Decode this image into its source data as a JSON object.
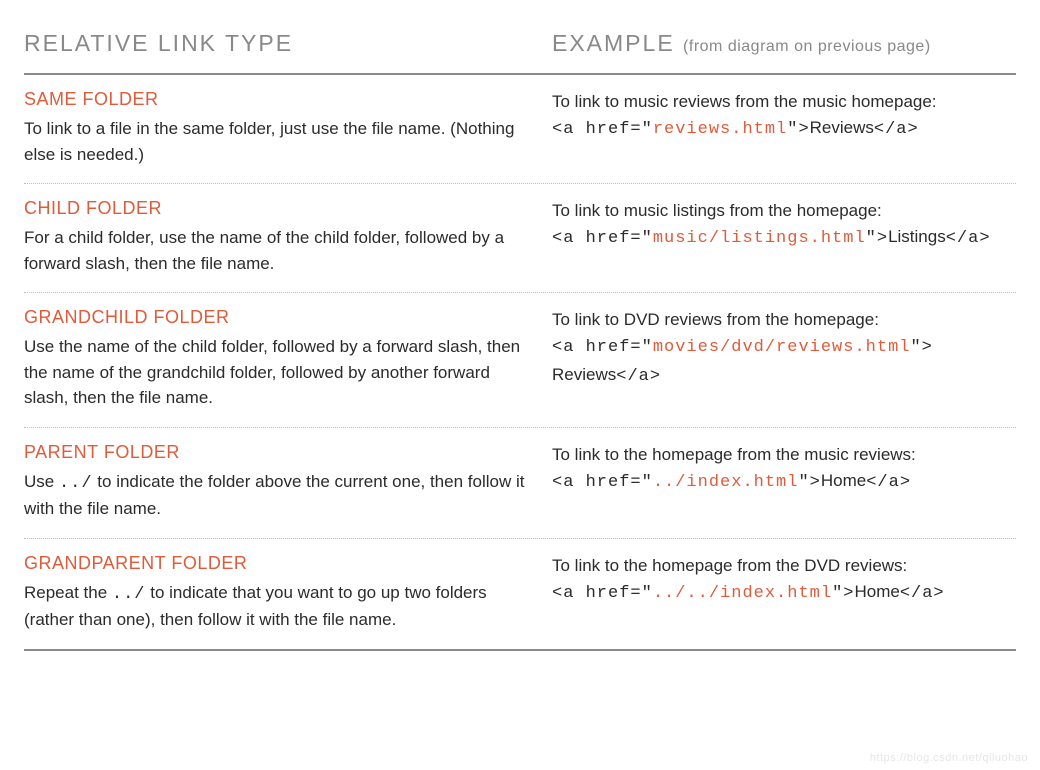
{
  "header": {
    "left": "RELATIVE LINK TYPE",
    "right": "EXAMPLE",
    "note": "(from diagram on previous page)"
  },
  "sections": [
    {
      "title": "SAME FOLDER",
      "desc": "To link to a file in the same folder, just use the file name. (Nothing else is needed.)",
      "example_intro": "To link to music reviews from the music homepage:",
      "code_prefix": "<a href=\"",
      "code_href": "reviews.html",
      "code_mid": "\">",
      "link_text": "Reviews",
      "code_suffix": "</a>"
    },
    {
      "title": "CHILD FOLDER",
      "desc": "For a child folder, use the name of the child folder, followed by a forward slash, then the file name.",
      "example_intro": "To link to music listings from the homepage:",
      "code_prefix": "<a href=\"",
      "code_href": "music/listings.html",
      "code_mid": "\">",
      "link_text": "Listings",
      "code_suffix": "</a>"
    },
    {
      "title": "GRANDCHILD FOLDER",
      "desc": "Use the name of the child folder, followed by a forward slash, then the name of the grandchild folder, followed by another forward slash, then the file name.",
      "example_intro": "To link to DVD reviews from the homepage:",
      "code_prefix": "<a href=\"",
      "code_href": "movies/dvd/reviews.html",
      "code_mid": "\">",
      "link_text": "Reviews",
      "code_suffix": "</a>"
    },
    {
      "title": "PARENT FOLDER",
      "desc_pre": "Use ",
      "desc_code": "../",
      "desc_post": " to indicate the folder above the current one, then follow it with the file name.",
      "example_intro": "To link to the homepage from the music reviews:",
      "code_prefix": "<a href=\"",
      "code_href": "../index.html",
      "code_mid": "\">",
      "link_text": "Home",
      "code_suffix": "</a>"
    },
    {
      "title": "GRANDPARENT FOLDER",
      "desc_pre": "Repeat the ",
      "desc_code": "../",
      "desc_post": " to indicate that you want to go up two folders (rather than one), then follow it with the file name.",
      "example_intro": "To link to the homepage from the DVD reviews:",
      "code_prefix": "<a href=\"",
      "code_href": "../../index.html",
      "code_mid": "\">",
      "link_text": "Home",
      "code_suffix": "</a>"
    }
  ],
  "watermark": "https://blog.csdn.net/qiluohao"
}
